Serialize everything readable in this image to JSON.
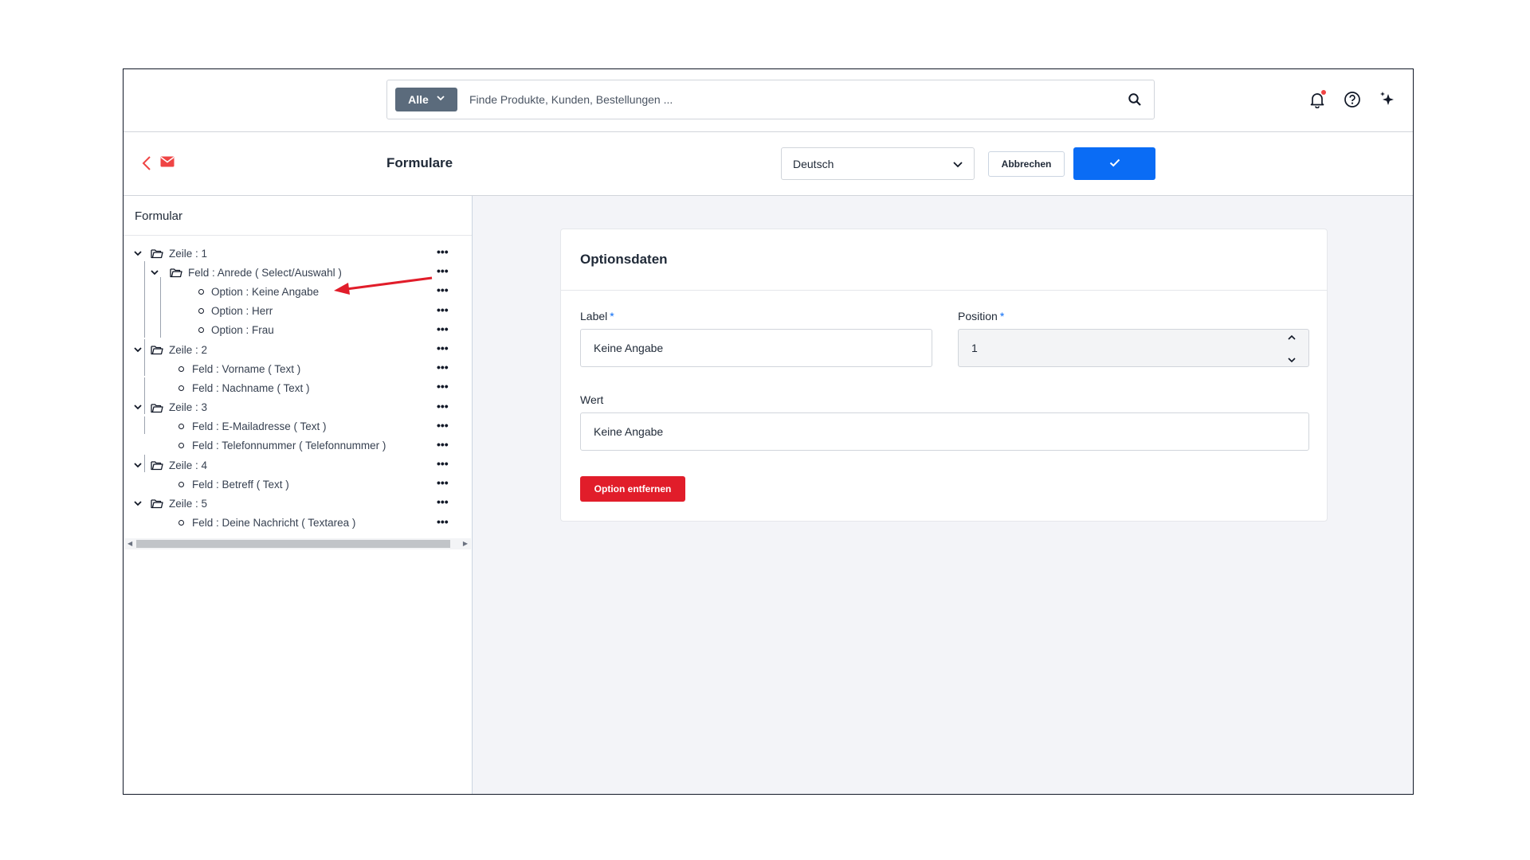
{
  "search": {
    "scope_label": "Alle",
    "placeholder": "Finde Produkte, Kunden, Bestellungen ..."
  },
  "header": {
    "title": "Formulare",
    "language": "Deutsch",
    "cancel_label": "Abbrechen"
  },
  "left_panel": {
    "title": "Formular",
    "tree": [
      {
        "label": "Zeile : 1",
        "kind": "row"
      },
      {
        "label": "Feld : Anrede ( Select/Auswahl )",
        "kind": "field-group"
      },
      {
        "label": "Option : Keine Angabe",
        "kind": "option"
      },
      {
        "label": "Option : Herr",
        "kind": "option"
      },
      {
        "label": "Option : Frau",
        "kind": "option"
      },
      {
        "label": "Zeile : 2",
        "kind": "row"
      },
      {
        "label": "Feld : Vorname ( Text )",
        "kind": "field"
      },
      {
        "label": "Feld : Nachname ( Text )",
        "kind": "field"
      },
      {
        "label": "Zeile : 3",
        "kind": "row"
      },
      {
        "label": "Feld : E-Mailadresse ( Text )",
        "kind": "field"
      },
      {
        "label": "Feld : Telefonnummer ( Telefonnummer )",
        "kind": "field"
      },
      {
        "label": "Zeile : 4",
        "kind": "row"
      },
      {
        "label": "Feld : Betreff ( Text )",
        "kind": "field"
      },
      {
        "label": "Zeile : 5",
        "kind": "row"
      },
      {
        "label": "Feld : Deine Nachricht ( Textarea )",
        "kind": "field"
      }
    ],
    "more_label": "•••"
  },
  "card": {
    "title": "Optionsdaten",
    "label_field": {
      "label": "Label",
      "required_mark": "*",
      "value": "Keine Angabe"
    },
    "position_field": {
      "label": "Position",
      "required_mark": "*",
      "value": "1"
    },
    "value_field": {
      "label": "Wert",
      "value": "Keine Angabe"
    },
    "remove_label": "Option entfernen"
  },
  "colors": {
    "primary": "#0a6cf5",
    "danger": "#e11d2a",
    "scope_button": "#5b6b7c",
    "annotation_arrow": "#e11d2a"
  },
  "icons": [
    "search-icon",
    "bell-icon",
    "help-icon",
    "sparkle-icon",
    "back-icon",
    "mail-icon",
    "chevron-down-icon",
    "check-icon",
    "folder-icon"
  ]
}
